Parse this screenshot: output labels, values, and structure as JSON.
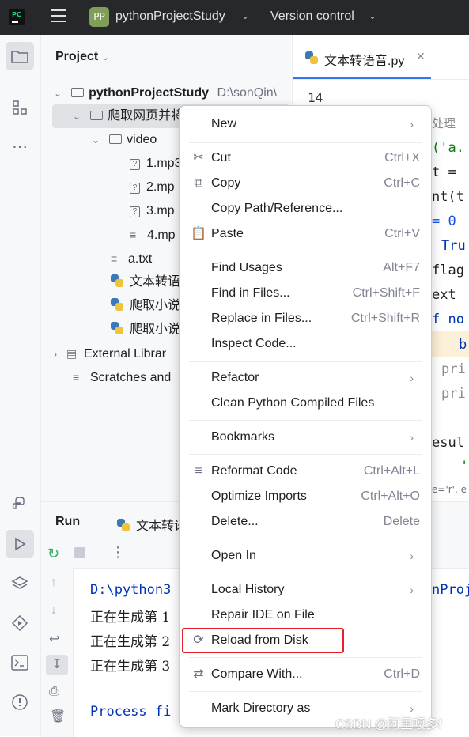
{
  "titlebar": {
    "project_avatar": "PP",
    "project_name": "pythonProjectStudy",
    "version_control": "Version control"
  },
  "project_pane": {
    "title": "Project",
    "tree": [
      {
        "label": "pythonProjectStudy",
        "path": "D:\\sonQin\\"
      },
      {
        "label": "爬取网页并将"
      },
      {
        "label": "video"
      },
      {
        "label": "1.mp3"
      },
      {
        "label": "2.mp"
      },
      {
        "label": "3.mp"
      },
      {
        "label": "4.mp"
      },
      {
        "label": "a.txt"
      },
      {
        "label": "文本转语"
      },
      {
        "label": "爬取小说"
      },
      {
        "label": "爬取小说"
      },
      {
        "label": "External Librar"
      },
      {
        "label": "Scratches and"
      }
    ]
  },
  "editor": {
    "tab_label": "文本转语音.py",
    "line_number": "14",
    "code_fragments": [
      "处理",
      "('a.",
      "t =",
      "nt(t",
      "= 0",
      "Tru",
      "flag",
      "ext",
      "f no",
      "b",
      "pri",
      "pri",
      "esul",
      "'",
      "e='r', e"
    ]
  },
  "run": {
    "title": "Run",
    "tab_label": "文本转语",
    "console": [
      "D:\\python3",
      "正在生成第 1",
      "正在生成第 2",
      "正在生成第 3",
      "Process fi"
    ],
    "console_tail": "nProj"
  },
  "context_menu": {
    "items": [
      {
        "label": "New",
        "shortcut": "",
        "submenu": true
      },
      {
        "label": "Cut",
        "shortcut": "Ctrl+X",
        "icon": "scissors-icon"
      },
      {
        "label": "Copy",
        "shortcut": "Ctrl+C",
        "icon": "copy-icon"
      },
      {
        "label": "Copy Path/Reference...",
        "shortcut": ""
      },
      {
        "label": "Paste",
        "shortcut": "Ctrl+V",
        "icon": "paste-icon"
      },
      {
        "label": "Find Usages",
        "shortcut": "Alt+F7"
      },
      {
        "label": "Find in Files...",
        "shortcut": "Ctrl+Shift+F"
      },
      {
        "label": "Replace in Files...",
        "shortcut": "Ctrl+Shift+R"
      },
      {
        "label": "Inspect Code...",
        "shortcut": ""
      },
      {
        "label": "Refactor",
        "shortcut": "",
        "submenu": true
      },
      {
        "label": "Clean Python Compiled Files",
        "shortcut": ""
      },
      {
        "label": "Bookmarks",
        "shortcut": "",
        "submenu": true
      },
      {
        "label": "Reformat Code",
        "shortcut": "Ctrl+Alt+L",
        "icon": "reformat-icon"
      },
      {
        "label": "Optimize Imports",
        "shortcut": "Ctrl+Alt+O"
      },
      {
        "label": "Delete...",
        "shortcut": "Delete"
      },
      {
        "label": "Open In",
        "shortcut": "",
        "submenu": true
      },
      {
        "label": "Local History",
        "shortcut": "",
        "submenu": true
      },
      {
        "label": "Repair IDE on File",
        "shortcut": ""
      },
      {
        "label": "Reload from Disk",
        "shortcut": "",
        "icon": "reload-icon"
      },
      {
        "label": "Compare With...",
        "shortcut": "Ctrl+D",
        "icon": "compare-icon"
      },
      {
        "label": "Mark Directory as",
        "shortcut": "",
        "submenu": true
      }
    ]
  },
  "watermark": "CSDN @阿里嘎多f",
  "colors": {
    "titlebar": "#27282c",
    "highlight_box": "#e8202a",
    "selection": "#dfe1e5",
    "accent": "#3574f0"
  }
}
